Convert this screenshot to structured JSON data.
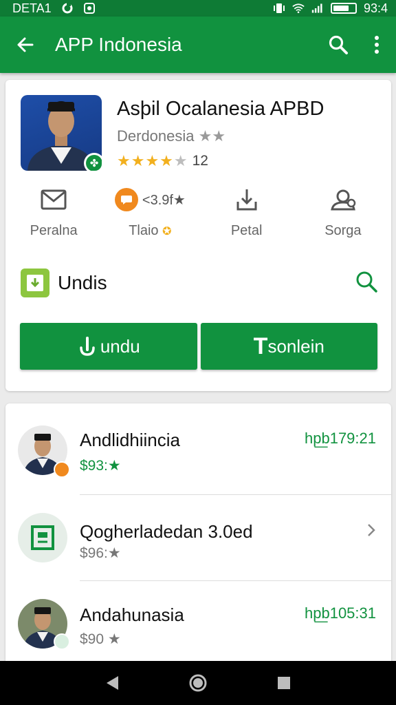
{
  "status_bar": {
    "carrier": "DETA1",
    "time": "93:4"
  },
  "app_bar": {
    "title": "APP Indonesia"
  },
  "app_card": {
    "name": "Asþil Ocalanesia APBD",
    "developer": "Derdonesia",
    "developer_stars": "★★",
    "rating_count": "12",
    "rating_value": 3.5,
    "quick_actions": [
      {
        "icon": "mail-icon",
        "label": "Peralna"
      },
      {
        "icon": "chat-icon",
        "label": "Tlaio",
        "value": "<3.9f★"
      },
      {
        "icon": "download-icon",
        "label": "Petal"
      },
      {
        "icon": "settings-icon",
        "label": "Sorga"
      }
    ],
    "section_title": "Undis",
    "buttons": {
      "primary_label": "undu",
      "secondary_letter": "T",
      "secondary_label": "sonlein"
    }
  },
  "list": [
    {
      "title": "Andlidhiincia",
      "subtitle": "$93:★",
      "time": "hp͟b179:21"
    },
    {
      "title": "Qogherladedan 3.0ed",
      "subtitle": "$96:★"
    },
    {
      "title": "Andahunasia",
      "subtitle": "$90 ★",
      "time": "hp͟b105:31"
    }
  ],
  "colors": {
    "primary": "#11923f",
    "status_bar": "#0e7b35",
    "star": "#f2b01e",
    "accent_orange": "#f0891e"
  }
}
